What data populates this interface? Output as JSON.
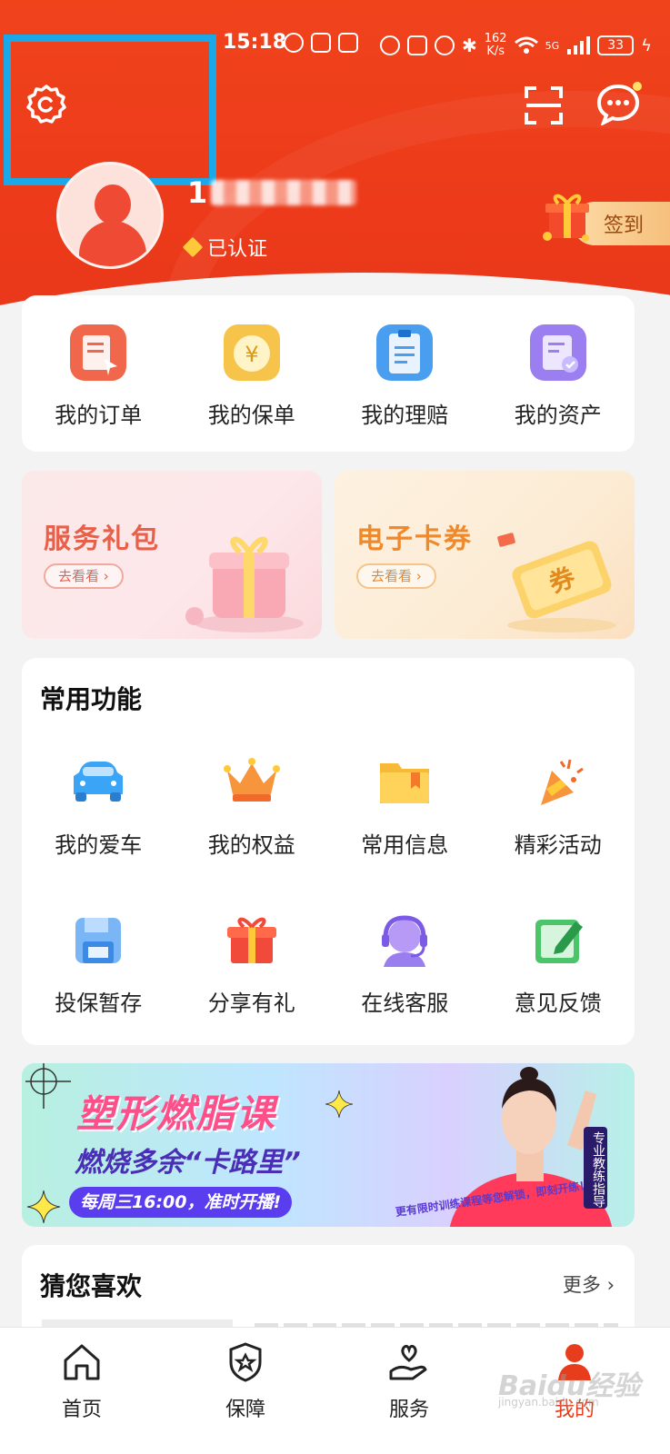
{
  "status_bar": {
    "time": "15:18",
    "net_speed_value": "162",
    "net_speed_unit": "K/s",
    "network": "5G",
    "battery": "33"
  },
  "header": {
    "username_visible": "1",
    "verified_label": "已认证",
    "checkin_label": "签到"
  },
  "orders": [
    {
      "label": "我的订单",
      "icon": "order-icon",
      "color": "#f0674b"
    },
    {
      "label": "我的保单",
      "icon": "policy-icon",
      "color": "#f6b93b"
    },
    {
      "label": "我的理赔",
      "icon": "claim-icon",
      "color": "#4a9ef0"
    },
    {
      "label": "我的资产",
      "icon": "asset-icon",
      "color": "#9b7ef0"
    }
  ],
  "promos": [
    {
      "title": "服务礼包",
      "action": "去看看 ›"
    },
    {
      "title": "电子卡券",
      "action": "去看看 ›",
      "art_text": "券"
    }
  ],
  "features": {
    "heading": "常用功能",
    "items": [
      {
        "label": "我的爱车",
        "icon": "car-icon"
      },
      {
        "label": "我的权益",
        "icon": "crown-icon"
      },
      {
        "label": "常用信息",
        "icon": "folder-icon"
      },
      {
        "label": "精彩活动",
        "icon": "party-popper-icon"
      },
      {
        "label": "投保暂存",
        "icon": "save-disk-icon"
      },
      {
        "label": "分享有礼",
        "icon": "gift-icon"
      },
      {
        "label": "在线客服",
        "icon": "headset-icon"
      },
      {
        "label": "意见反馈",
        "icon": "feedback-icon"
      }
    ]
  },
  "banner": {
    "title": "塑形燃脂课",
    "subtitle": "燃烧多余“卡路里”",
    "schedule": "每周三16:00，准时开播!",
    "tag": "专业教练指导",
    "note": "更有限时训练课程等您解锁，即刻开练！"
  },
  "guess": {
    "heading": "猜您喜欢",
    "more": "更多"
  },
  "tabs": [
    {
      "label": "首页",
      "icon": "home-icon"
    },
    {
      "label": "保障",
      "icon": "shield-star-icon"
    },
    {
      "label": "服务",
      "icon": "hand-heart-icon"
    },
    {
      "label": "我的",
      "icon": "user-icon"
    }
  ],
  "watermark": {
    "text": "Baidu经验",
    "sub": "jingyan.baidu.com"
  },
  "colors": {
    "brand": "#ec3a1a",
    "highlight": "#1ba8e8"
  }
}
